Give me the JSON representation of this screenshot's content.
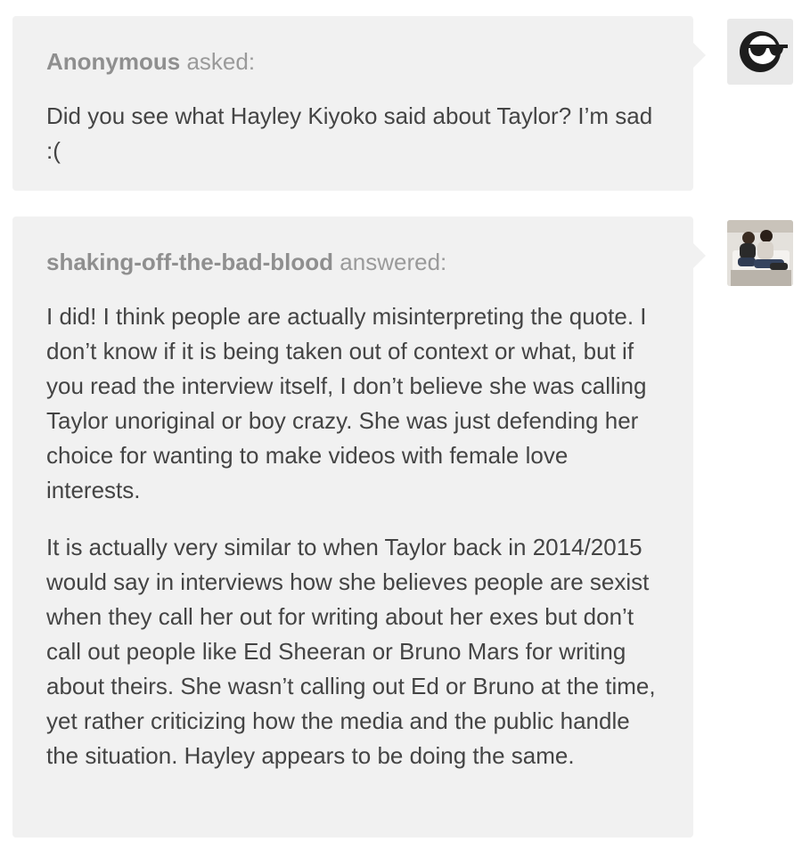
{
  "ask": {
    "author": "Anonymous",
    "verb": "asked:",
    "text": "Did you see what Hayley Kiyoko said about Taylor? I’m sad :(",
    "avatar_icon": "sunglasses-face-icon"
  },
  "answer": {
    "author": "shaking-off-the-bad-blood",
    "verb": "answered:",
    "avatar_icon": "user-photo-avatar",
    "paragraphs": [
      "I did! I think people are actually misinterpreting the quote. I don’t know if it is being taken out of context or what, but if you read the interview itself, I don’t believe she was calling Taylor unoriginal or boy crazy. She was just defending her choice for wanting to make videos with female love interests.",
      "It is actually very similar to when Taylor back in 2014/2015 would say in interviews how she believes people are sexist when they call her out for writing about her exes but don’t call out people like Ed Sheeran or Bruno Mars for writing about theirs. She wasn’t calling out Ed or Bruno at the time, yet rather criticizing how the media and the public handle the situation. Hayley appears to be doing the same."
    ]
  }
}
